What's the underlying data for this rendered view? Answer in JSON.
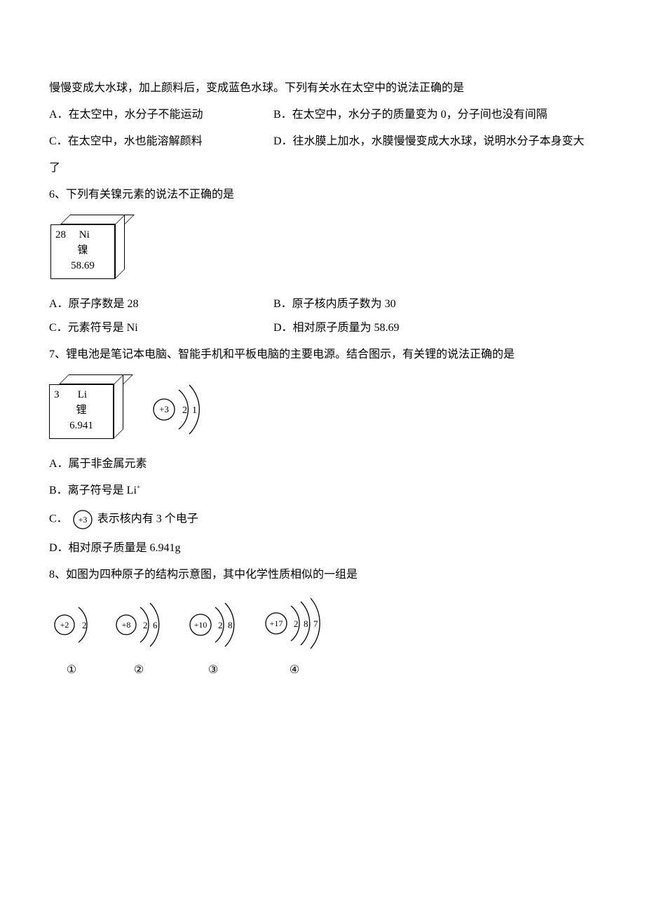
{
  "intro": {
    "line1": "慢慢变成大水球，加上颜料后，变成蓝色水球。下列有关水在太空中的说法正确的是"
  },
  "q5": {
    "A": "A．在太空中，水分子不能运动",
    "B": "B．在太空中，水分子的质量变为 0，分子间也没有间隔",
    "C": "C．在太空中，水也能溶解颜料",
    "D_part1": "D．往水膜上加水，水膜慢慢变成大水球，说明水分子本身变大",
    "D_part2": "了"
  },
  "q6": {
    "stem": "6、下列有关镍元素的说法不正确的是",
    "cell": {
      "num": "28",
      "sym": "Ni",
      "name": "镍",
      "mass": "58.69"
    },
    "A": "A．原子序数是 28",
    "B": "B．原子核内质子数为 30",
    "C": "C．元素符号是 Ni",
    "D": "D．相对原子质量为 58.69"
  },
  "q7": {
    "stem": "7、锂电池是笔记本电脑、智能手机和平板电脑的主要电源。结合图示，有关锂的说法正确的是",
    "cell": {
      "num": "3",
      "sym": "Li",
      "name": "锂",
      "mass": "6.941"
    },
    "atom": {
      "core": "+3",
      "shells": [
        "2",
        "1"
      ]
    },
    "A": "A．属于非金属元素",
    "B": "B．离子符号是 Li",
    "B_sup": "+",
    "C_pre": "C．",
    "C_core": "+3",
    "C_post": " 表示核内有 3 个电子",
    "D": "D．相对原子质量是 6.941g"
  },
  "q8": {
    "stem": "8、如图为四种原子的结构示意图，其中化学性质相似的一组是",
    "atoms": [
      {
        "core": "+2",
        "shells": [
          "2"
        ],
        "label": "①"
      },
      {
        "core": "+8",
        "shells": [
          "2",
          "6"
        ],
        "label": "②"
      },
      {
        "core": "+10",
        "shells": [
          "2",
          "8"
        ],
        "label": "③"
      },
      {
        "core": "+17",
        "shells": [
          "2",
          "8",
          "7"
        ],
        "label": "④"
      }
    ]
  }
}
